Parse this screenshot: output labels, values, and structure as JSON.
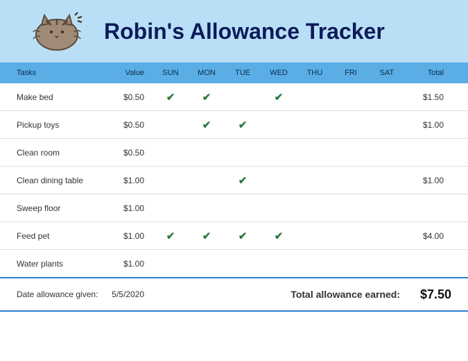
{
  "title": "Robin's Allowance Tracker",
  "columns": {
    "tasks": "Tasks",
    "value": "Value",
    "days": [
      "SUN",
      "MON",
      "TUE",
      "WED",
      "THU",
      "FRI",
      "SAT"
    ],
    "total": "Total"
  },
  "rows": [
    {
      "task": "Make bed",
      "value": "$0.50",
      "checks": [
        true,
        true,
        false,
        true,
        false,
        false,
        false
      ],
      "total": "$1.50"
    },
    {
      "task": "Pickup toys",
      "value": "$0.50",
      "checks": [
        false,
        true,
        true,
        false,
        false,
        false,
        false
      ],
      "total": "$1.00"
    },
    {
      "task": "Clean room",
      "value": "$0.50",
      "checks": [
        false,
        false,
        false,
        false,
        false,
        false,
        false
      ],
      "total": ""
    },
    {
      "task": "Clean dining table",
      "value": "$1.00",
      "checks": [
        false,
        false,
        true,
        false,
        false,
        false,
        false
      ],
      "total": "$1.00"
    },
    {
      "task": "Sweep floor",
      "value": "$1.00",
      "checks": [
        false,
        false,
        false,
        false,
        false,
        false,
        false
      ],
      "total": ""
    },
    {
      "task": "Feed pet",
      "value": "$1.00",
      "checks": [
        true,
        true,
        true,
        true,
        false,
        false,
        false
      ],
      "total": "$4.00"
    },
    {
      "task": "Water plants",
      "value": "$1.00",
      "checks": [
        false,
        false,
        false,
        false,
        false,
        false,
        false
      ],
      "total": ""
    }
  ],
  "footer": {
    "date_label": "Date allowance given:",
    "date": "5/5/2020",
    "total_label": "Total allowance earned:",
    "total": "$7.50"
  },
  "chart_data": {
    "type": "table",
    "title": "Robin's Allowance Tracker",
    "columns": [
      "Tasks",
      "Value",
      "SUN",
      "MON",
      "TUE",
      "WED",
      "THU",
      "FRI",
      "SAT",
      "Total"
    ],
    "rows": [
      [
        "Make bed",
        "$0.50",
        "✔",
        "✔",
        "",
        "✔",
        "",
        "",
        "",
        "$1.50"
      ],
      [
        "Pickup toys",
        "$0.50",
        "",
        "✔",
        "✔",
        "",
        "",
        "",
        "",
        "$1.00"
      ],
      [
        "Clean room",
        "$0.50",
        "",
        "",
        "",
        "",
        "",
        "",
        "",
        ""
      ],
      [
        "Clean dining table",
        "$1.00",
        "",
        "",
        "✔",
        "",
        "",
        "",
        "",
        "$1.00"
      ],
      [
        "Sweep floor",
        "$1.00",
        "",
        "",
        "",
        "",
        "",
        "",
        "",
        ""
      ],
      [
        "Feed pet",
        "$1.00",
        "✔",
        "✔",
        "✔",
        "✔",
        "",
        "",
        "",
        "$4.00"
      ],
      [
        "Water plants",
        "$1.00",
        "",
        "",
        "",
        "",
        "",
        "",
        "",
        ""
      ]
    ],
    "footer": {
      "Date allowance given": "5/5/2020",
      "Total allowance earned": "$7.50"
    }
  }
}
